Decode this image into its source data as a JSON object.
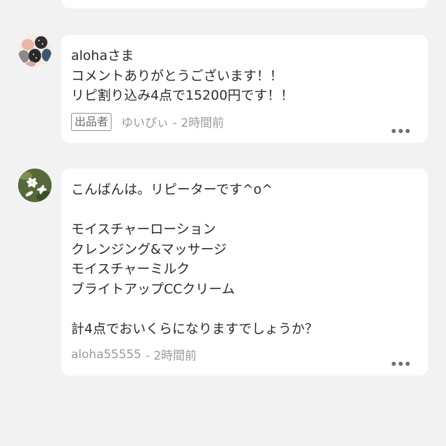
{
  "comments": [
    {
      "lines": [
        "alohaさま",
        "コメントありがとうございます！！",
        "リピ割り込み4点で15200円です！！"
      ],
      "badge": "出品者",
      "author": "ゆいぴぃ",
      "time": "- 2時間前"
    },
    {
      "lines": [
        "こんばんは。リピーターです^o^",
        "",
        "モイスチャーローション",
        "クレンジング&マッサージ",
        "モイスチャーミルク",
        "ブライトアップCCクリーム",
        "",
        "計4点でおいくらになりますでしょうか？"
      ],
      "author": "aloha55555",
      "time": "- 2時間前"
    }
  ],
  "icons": {
    "more": "more-options-icon"
  }
}
